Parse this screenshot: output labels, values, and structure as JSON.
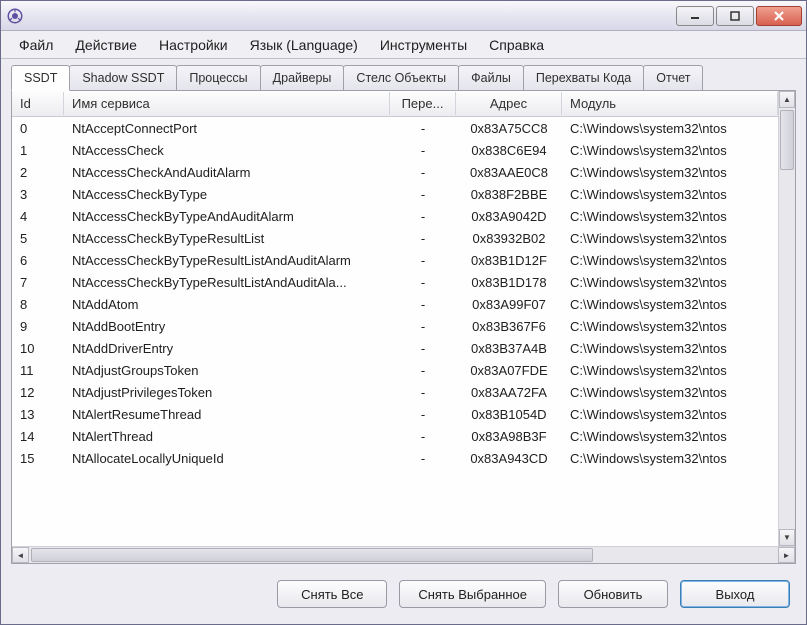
{
  "menubar": {
    "items": [
      "Файл",
      "Действие",
      "Настройки",
      "Язык (Language)",
      "Инструменты",
      "Справка"
    ]
  },
  "tabs": {
    "items": [
      "SSDT",
      "Shadow SSDT",
      "Процессы",
      "Драйверы",
      "Стелс Объекты",
      "Файлы",
      "Перехваты Кода",
      "Отчет"
    ],
    "active": 0
  },
  "listview": {
    "columns": [
      "Id",
      "Имя сервиса",
      "Пере...",
      "Адрес",
      "Модуль"
    ],
    "rows": [
      {
        "id": "0",
        "name": "NtAcceptConnectPort",
        "hook": "-",
        "addr": "0x83A75CC8",
        "mod": "C:\\Windows\\system32\\ntos"
      },
      {
        "id": "1",
        "name": "NtAccessCheck",
        "hook": "-",
        "addr": "0x838C6E94",
        "mod": "C:\\Windows\\system32\\ntos"
      },
      {
        "id": "2",
        "name": "NtAccessCheckAndAuditAlarm",
        "hook": "-",
        "addr": "0x83AAE0C8",
        "mod": "C:\\Windows\\system32\\ntos"
      },
      {
        "id": "3",
        "name": "NtAccessCheckByType",
        "hook": "-",
        "addr": "0x838F2BBE",
        "mod": "C:\\Windows\\system32\\ntos"
      },
      {
        "id": "4",
        "name": "NtAccessCheckByTypeAndAuditAlarm",
        "hook": "-",
        "addr": "0x83A9042D",
        "mod": "C:\\Windows\\system32\\ntos"
      },
      {
        "id": "5",
        "name": "NtAccessCheckByTypeResultList",
        "hook": "-",
        "addr": "0x83932B02",
        "mod": "C:\\Windows\\system32\\ntos"
      },
      {
        "id": "6",
        "name": "NtAccessCheckByTypeResultListAndAuditAlarm",
        "hook": "-",
        "addr": "0x83B1D12F",
        "mod": "C:\\Windows\\system32\\ntos"
      },
      {
        "id": "7",
        "name": "NtAccessCheckByTypeResultListAndAuditAla...",
        "hook": "-",
        "addr": "0x83B1D178",
        "mod": "C:\\Windows\\system32\\ntos"
      },
      {
        "id": "8",
        "name": "NtAddAtom",
        "hook": "-",
        "addr": "0x83A99F07",
        "mod": "C:\\Windows\\system32\\ntos"
      },
      {
        "id": "9",
        "name": "NtAddBootEntry",
        "hook": "-",
        "addr": "0x83B367F6",
        "mod": "C:\\Windows\\system32\\ntos"
      },
      {
        "id": "10",
        "name": "NtAddDriverEntry",
        "hook": "-",
        "addr": "0x83B37A4B",
        "mod": "C:\\Windows\\system32\\ntos"
      },
      {
        "id": "11",
        "name": "NtAdjustGroupsToken",
        "hook": "-",
        "addr": "0x83A07FDE",
        "mod": "C:\\Windows\\system32\\ntos"
      },
      {
        "id": "12",
        "name": "NtAdjustPrivilegesToken",
        "hook": "-",
        "addr": "0x83AA72FA",
        "mod": "C:\\Windows\\system32\\ntos"
      },
      {
        "id": "13",
        "name": "NtAlertResumeThread",
        "hook": "-",
        "addr": "0x83B1054D",
        "mod": "C:\\Windows\\system32\\ntos"
      },
      {
        "id": "14",
        "name": "NtAlertThread",
        "hook": "-",
        "addr": "0x83A98B3F",
        "mod": "C:\\Windows\\system32\\ntos"
      },
      {
        "id": "15",
        "name": "NtAllocateLocallyUniqueId",
        "hook": "-",
        "addr": "0x83A943CD",
        "mod": "C:\\Windows\\system32\\ntos"
      }
    ]
  },
  "buttons": {
    "deselect_all": "Снять Все",
    "deselect_selected": "Снять Выбранное",
    "refresh": "Обновить",
    "exit": "Выход"
  }
}
